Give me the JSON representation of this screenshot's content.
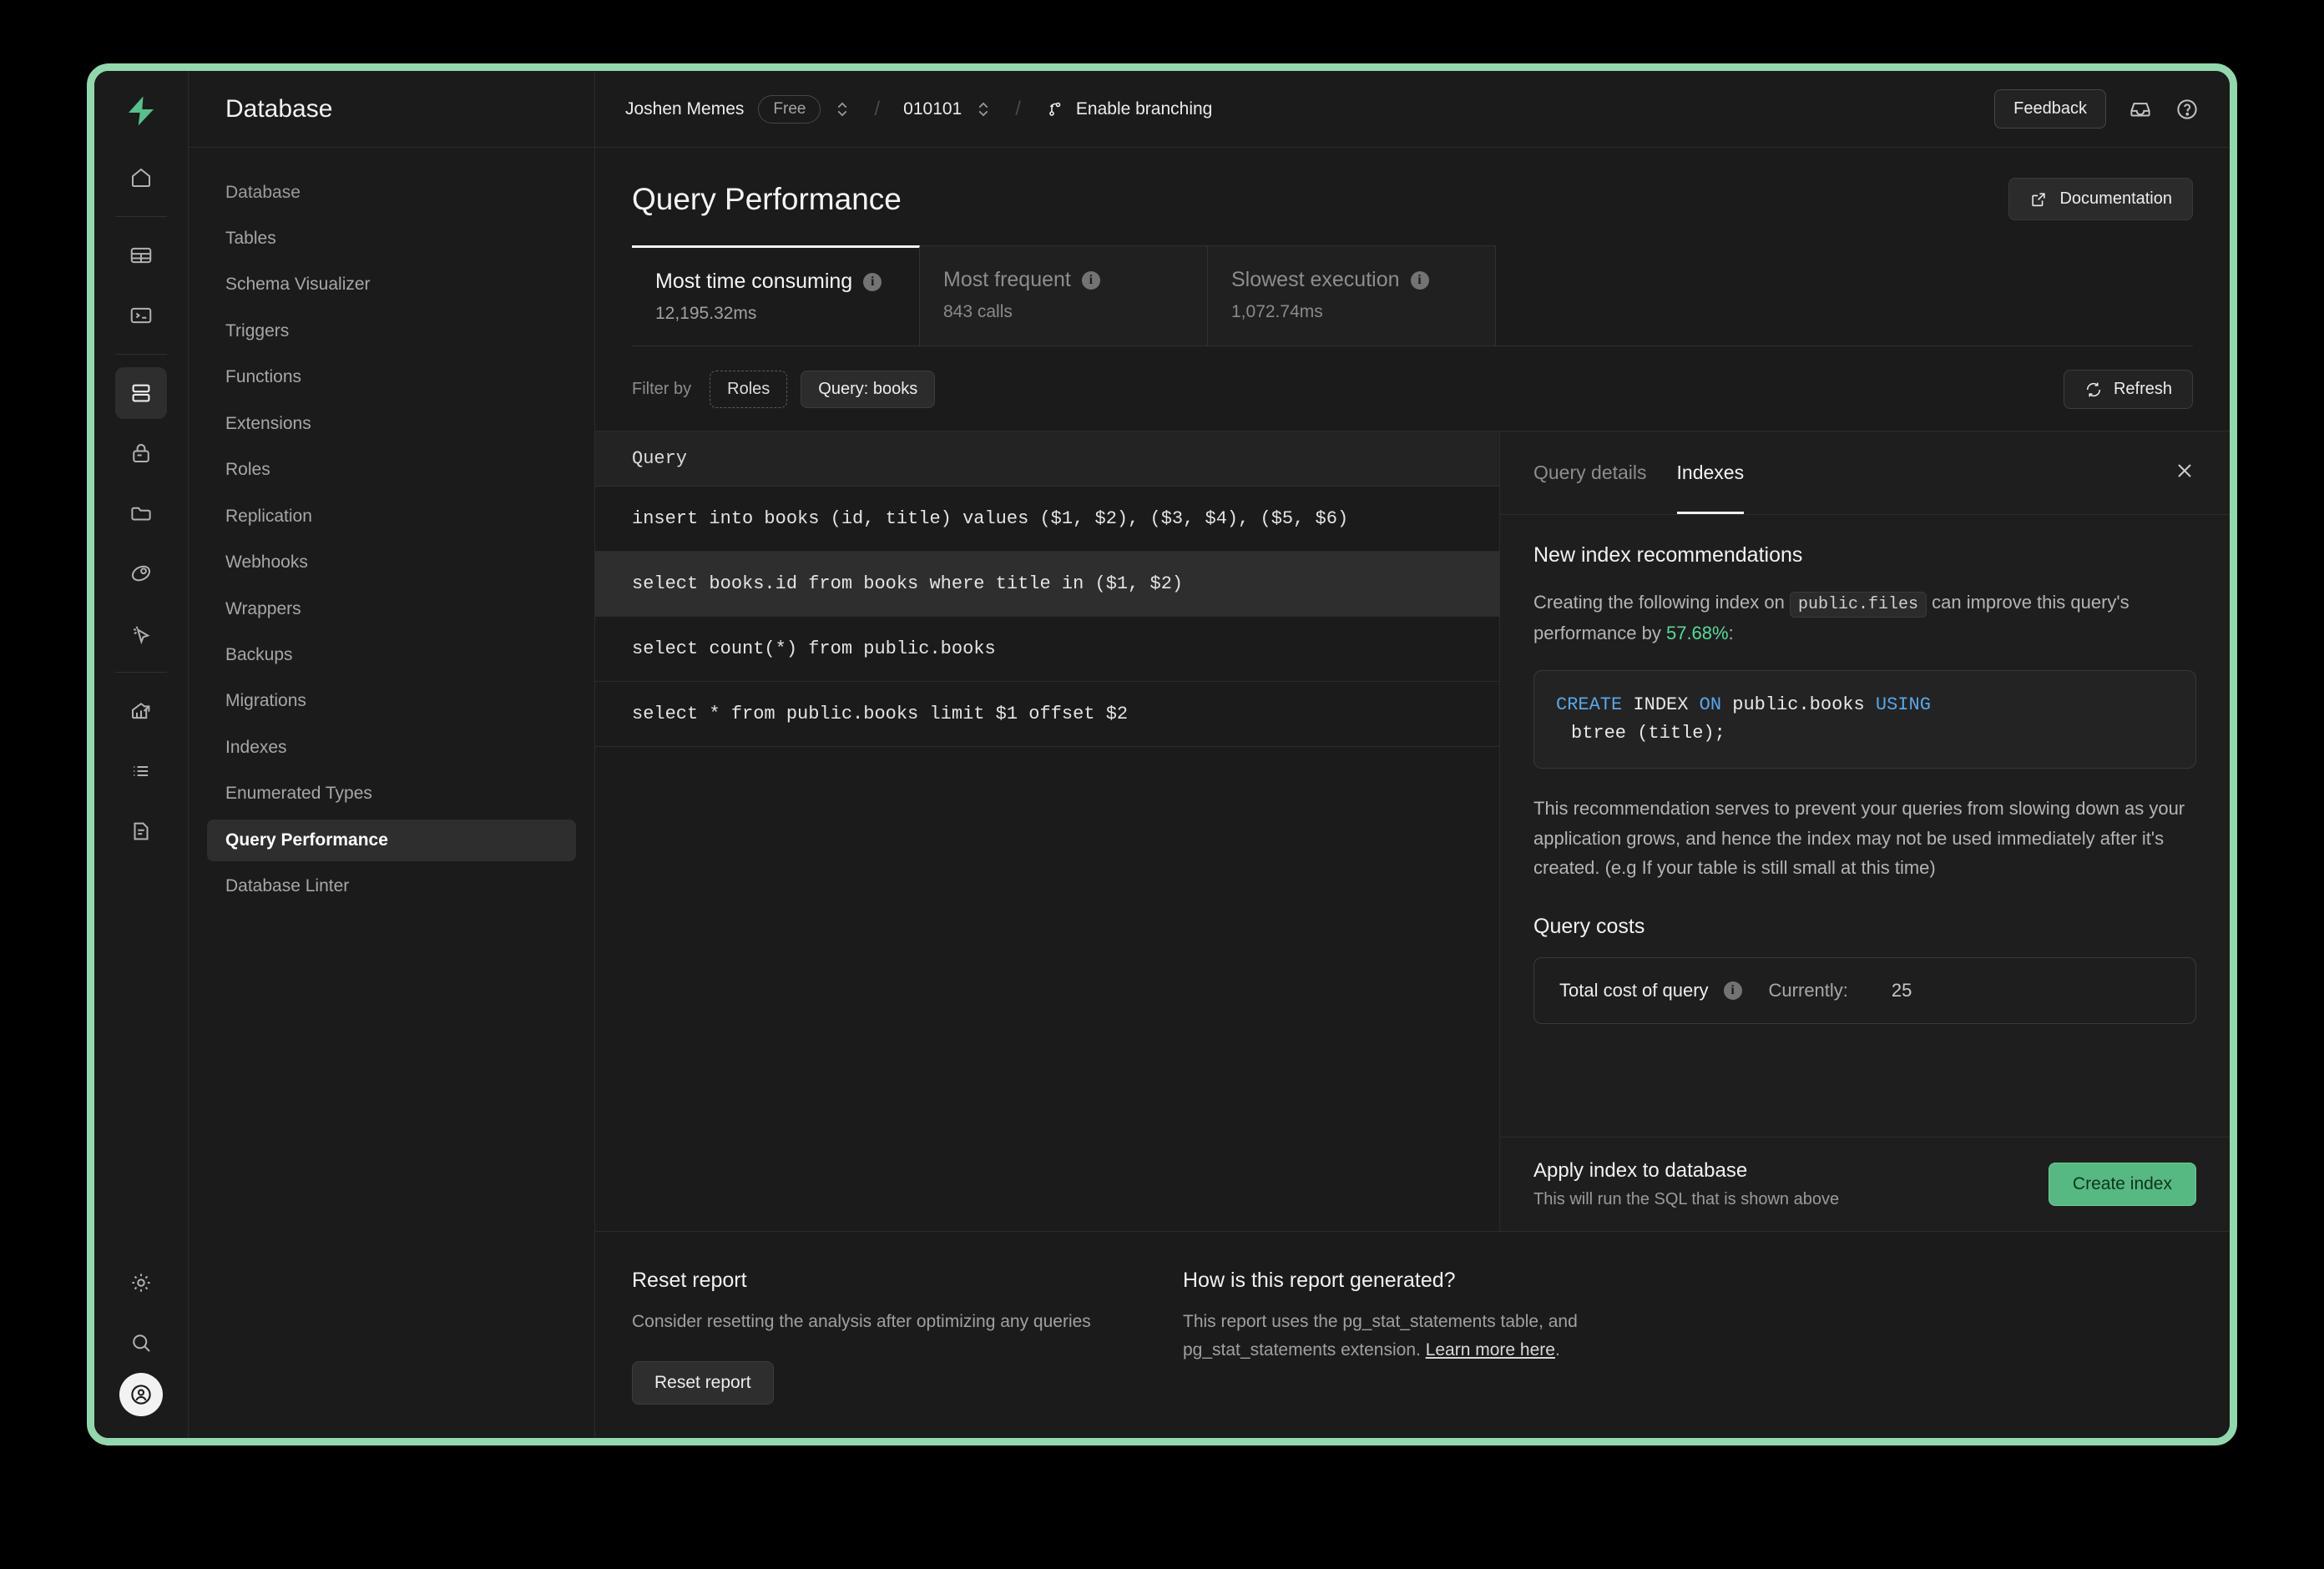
{
  "window": {
    "border_color": "#93d7ad"
  },
  "rail": {
    "logo": "supabase-logo-icon",
    "items": [
      {
        "name": "home-icon",
        "active": false
      },
      {
        "name": "table-editor-icon",
        "active": false
      },
      {
        "name": "sql-editor-icon",
        "active": false
      },
      {
        "name": "database-icon",
        "active": true
      },
      {
        "name": "auth-lock-icon",
        "active": false
      },
      {
        "name": "storage-folder-icon",
        "active": false
      },
      {
        "name": "edge-functions-icon",
        "active": false
      },
      {
        "name": "realtime-cursor-icon",
        "active": false
      },
      {
        "name": "reports-chart-icon",
        "active": false
      },
      {
        "name": "logs-list-icon",
        "active": false
      },
      {
        "name": "api-docs-icon",
        "active": false
      },
      {
        "name": "settings-gear-icon",
        "active": false
      },
      {
        "name": "search-icon",
        "active": false
      }
    ],
    "avatar": "user-avatar"
  },
  "sidebar": {
    "title": "Database",
    "group_label": "Database",
    "items": [
      {
        "label": "Tables",
        "active": false
      },
      {
        "label": "Schema Visualizer",
        "active": false
      },
      {
        "label": "Triggers",
        "active": false
      },
      {
        "label": "Functions",
        "active": false
      },
      {
        "label": "Extensions",
        "active": false
      },
      {
        "label": "Roles",
        "active": false
      },
      {
        "label": "Replication",
        "active": false
      },
      {
        "label": "Webhooks",
        "active": false
      },
      {
        "label": "Wrappers",
        "active": false
      },
      {
        "label": "Backups",
        "active": false
      },
      {
        "label": "Migrations",
        "active": false
      },
      {
        "label": "Indexes",
        "active": false
      },
      {
        "label": "Enumerated Types",
        "active": false
      },
      {
        "label": "Query Performance",
        "active": true
      },
      {
        "label": "Database Linter",
        "active": false
      }
    ]
  },
  "topbar": {
    "org": "Joshen Memes",
    "plan_badge": "Free",
    "project": "010101",
    "branching_label": "Enable branching",
    "feedback_label": "Feedback",
    "inbox_icon": "inbox-icon",
    "help_icon": "help-circle-icon",
    "separator": "/"
  },
  "page": {
    "title": "Query Performance",
    "documentation_label": "Documentation",
    "documentation_icon": "external-link-icon"
  },
  "tabs": [
    {
      "label": "Most time consuming",
      "sub": "12,195.32ms",
      "active": true
    },
    {
      "label": "Most frequent",
      "sub": "843 calls",
      "active": false
    },
    {
      "label": "Slowest execution",
      "sub": "1,072.74ms",
      "active": false
    }
  ],
  "filterbar": {
    "label": "Filter by",
    "roles_chip": "Roles",
    "query_chip": "Query: books",
    "refresh_label": "Refresh",
    "refresh_icon": "refresh-icon"
  },
  "query_table": {
    "header": "Query",
    "rows": [
      {
        "sql": "insert into books (id, title) values ($1, $2), ($3, $4), ($5, $6)",
        "selected": false
      },
      {
        "sql": "select books.id from books where title in ($1, $2)",
        "selected": true
      },
      {
        "sql": "select count(*) from public.books",
        "selected": false
      },
      {
        "sql": "select * from public.books limit $1 offset $2",
        "selected": false
      }
    ]
  },
  "right_panel": {
    "tabs": [
      {
        "label": "Query details",
        "active": false
      },
      {
        "label": "Indexes",
        "active": true
      }
    ],
    "close_icon": "close-icon",
    "heading": "New index recommendations",
    "desc_before": "Creating the following index on ",
    "desc_table": "public.files",
    "desc_mid": " can improve this query's performance by ",
    "desc_pct": "57.68%",
    "desc_after": ":",
    "code_line1_kw1": "CREATE",
    "code_line1_mid1": " INDEX ",
    "code_line1_kw2": "ON",
    "code_line1_mid2": " public.books ",
    "code_line1_kw3": "USING",
    "code_line2": "btree (title);",
    "note": "This recommendation serves to prevent your queries from slowing down as your application grows, and hence the index may not be used immediately after it's created. (e.g If your table is still small at this time)",
    "costs_heading": "Query costs",
    "cost_label": "Total cost of query",
    "cost_currently": "Currently:",
    "cost_value": "25",
    "footer_title": "Apply index to database",
    "footer_sub": "This will run the SQL that is shown above",
    "create_button": "Create index",
    "accent_green": "#56b981",
    "pct_green": "#5bd99a"
  },
  "bottom": {
    "reset_title": "Reset report",
    "reset_text": "Consider resetting the analysis after optimizing any queries",
    "reset_button": "Reset report",
    "how_title": "How is this report generated?",
    "how_text_1": "This report uses the pg_stat_statements table, and",
    "how_text_2": "pg_stat_statements extension. ",
    "how_link": "Learn more here",
    "how_text_3": "."
  }
}
